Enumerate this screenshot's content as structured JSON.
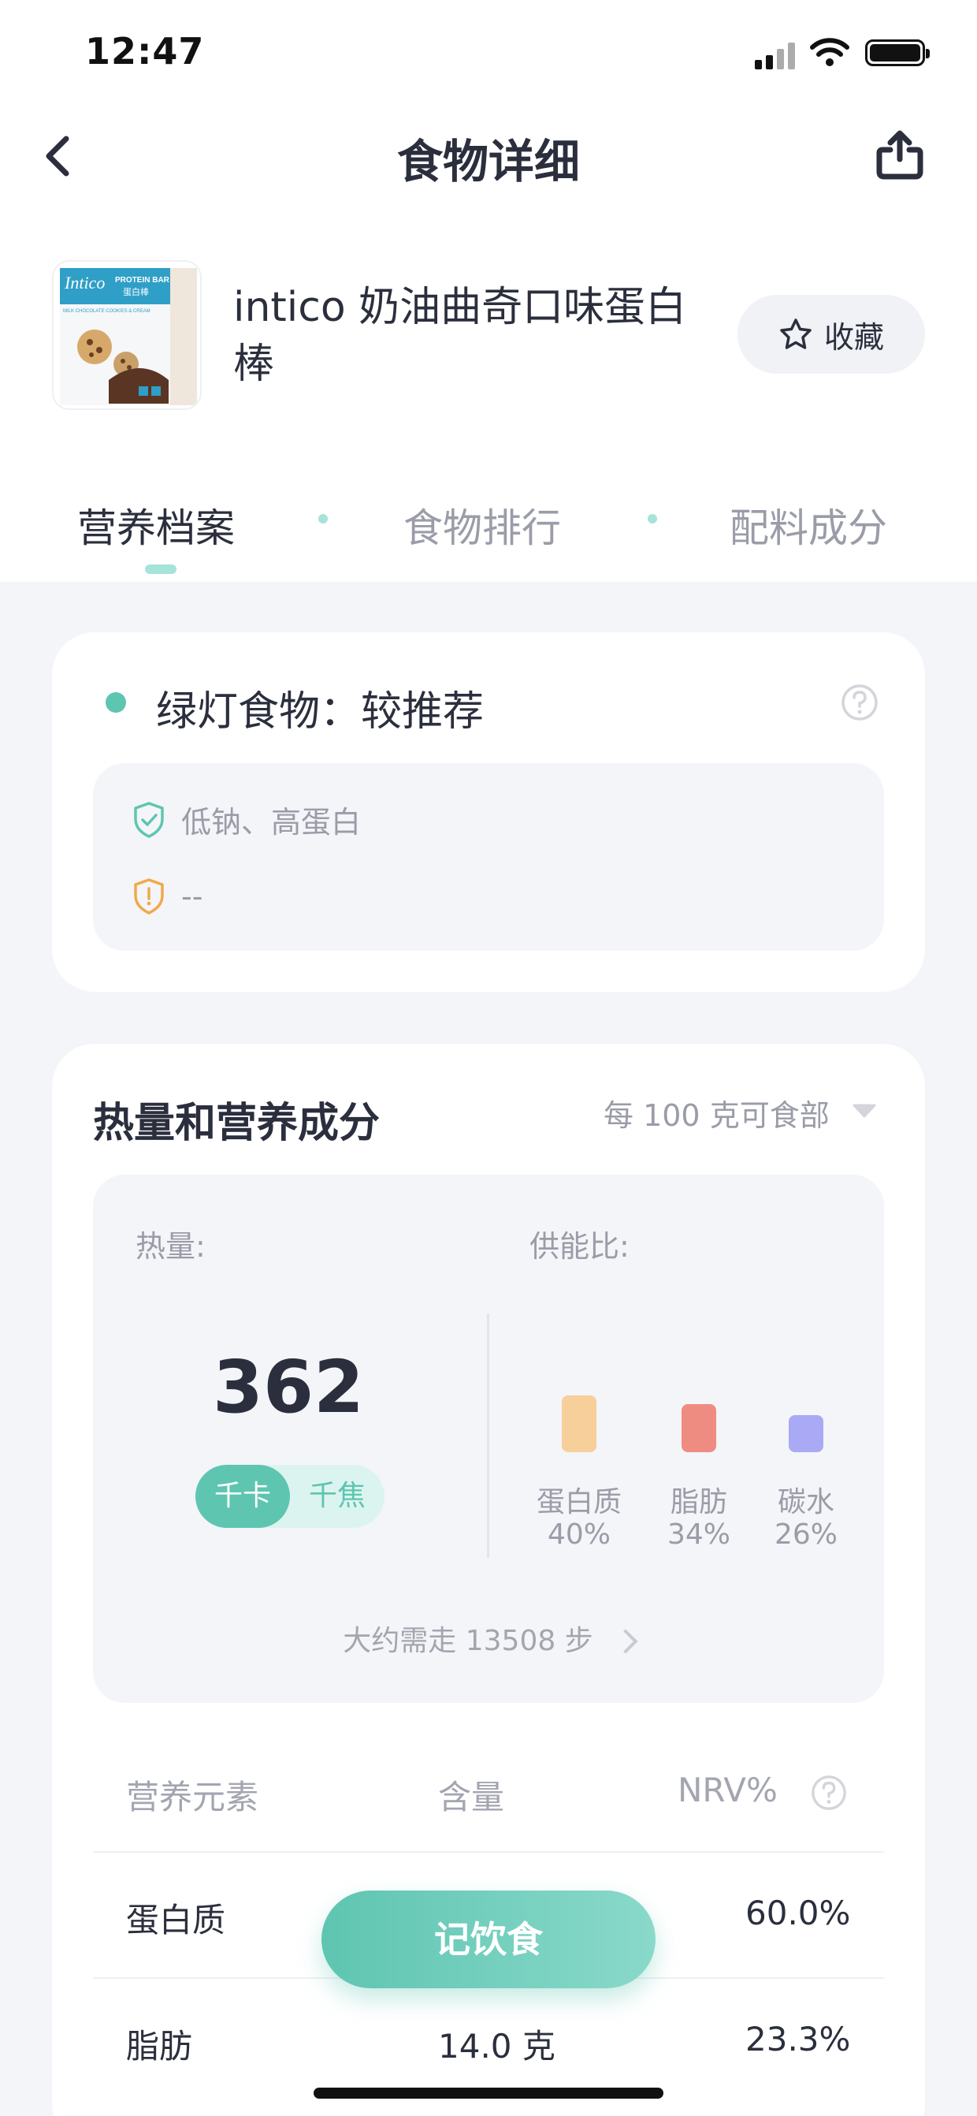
{
  "status_bar": {
    "time": "12:47"
  },
  "nav": {
    "title": "食物详细"
  },
  "food": {
    "name": "intico 奶油曲奇口味蛋白棒",
    "image_text": {
      "brand": "Intico",
      "line1": "PROTEIN BAR",
      "line2": "蛋白棒",
      "line3": "MILK CHOCOLATE COOKIES & CREAM"
    },
    "favorite_label": "收藏"
  },
  "tabs": [
    {
      "label": "营养档案",
      "active": true
    },
    {
      "label": "食物排行",
      "active": false
    },
    {
      "label": "配料成分",
      "active": false
    }
  ],
  "rating": {
    "title": "绿灯食物：较推荐",
    "good_tags": "低钠、高蛋白",
    "bad_tags": "--",
    "color": "#5ec5b1"
  },
  "nutrition": {
    "title": "热量和营养成分",
    "per_unit": "每 100 克可食部",
    "energy_label": "热量:",
    "ratio_label": "供能比:",
    "energy_value": "362",
    "unit_kcal": "千卡",
    "unit_kj": "千焦",
    "macros": [
      {
        "name": "蛋白质",
        "percent": "40%",
        "value": 40,
        "color": "#f7cf9a"
      },
      {
        "name": "脂肪",
        "percent": "34%",
        "value": 34,
        "color": "#ef8c82"
      },
      {
        "name": "碳水",
        "percent": "26%",
        "value": 26,
        "color": "#a9a9f5"
      }
    ],
    "steps_text": "大约需走 13508 步",
    "table": {
      "headers": [
        "营养元素",
        "含量",
        "NRV%"
      ],
      "rows": [
        {
          "name": "蛋白质",
          "amount": "",
          "nrv": "60.0%"
        },
        {
          "name": "脂肪",
          "amount": "14.0 克",
          "nrv": "23.3%"
        }
      ]
    }
  },
  "record_button": "记饮食"
}
